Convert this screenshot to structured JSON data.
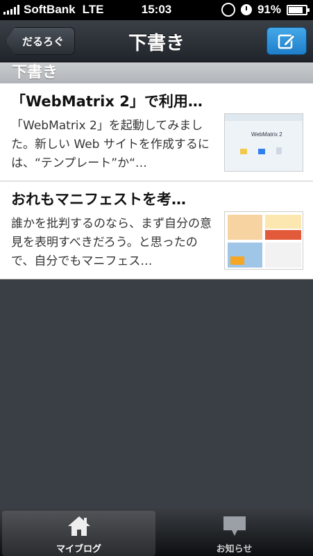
{
  "status": {
    "carrier": "SoftBank",
    "network": "LTE",
    "time": "15:03",
    "battery": "91%"
  },
  "nav": {
    "back_label": "だるろぐ",
    "title": "下書き",
    "compose_icon": "compose-icon"
  },
  "section": {
    "header": "下書き"
  },
  "drafts": [
    {
      "title": "「WebMatrix 2」で利用…",
      "excerpt": "「WebMatrix 2」を起動してみました。新しい Web サイトを作成するには、“テンプレート”か“…",
      "thumb_caption": "WebMatrix 2"
    },
    {
      "title": "おれもマニフェストを考…",
      "excerpt": "誰かを批判するのなら、まず自分の意見を表明すべきだろう。と思ったので、自分でもマニフェス…"
    }
  ],
  "tabs": [
    {
      "label": "マイブログ",
      "icon": "home-icon",
      "active": true
    },
    {
      "label": "お知らせ",
      "icon": "speech-bubble-icon",
      "active": false
    }
  ],
  "colors": {
    "accent": "#2a8fd6",
    "background": "#3a3f45"
  }
}
